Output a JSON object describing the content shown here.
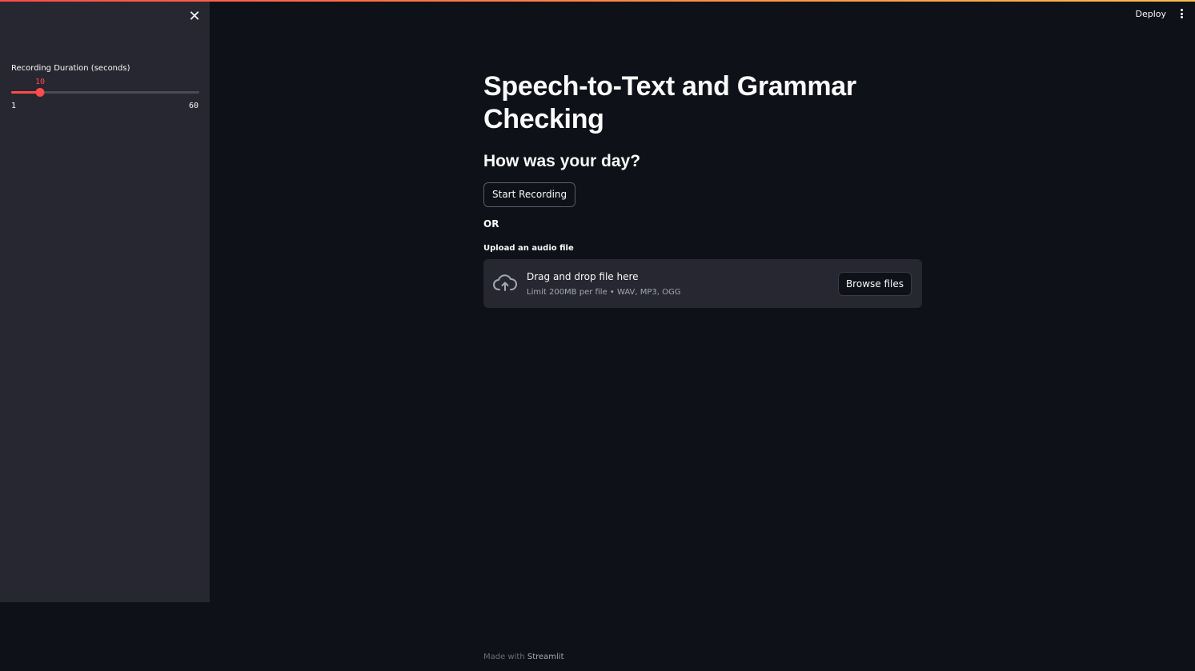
{
  "colors": {
    "accent": "#ff4b4b",
    "background": "#0e1117",
    "sidebar": "#262730"
  },
  "sidebar": {
    "close_icon": "close-icon",
    "slider": {
      "label": "Recording Duration (seconds)",
      "value": "10",
      "min": "1",
      "max": "60",
      "level": 0.153
    }
  },
  "header": {
    "deploy_label": "Deploy",
    "menu_icon": "vertical-ellipsis-icon"
  },
  "main": {
    "title": "Speech-to-Text and Grammar Checking",
    "subheader": "How was your day?",
    "record_button": "Start Recording",
    "or_text": "OR",
    "upload": {
      "label": "Upload an audio file",
      "icon": "cloud-upload-icon",
      "drop_title": "Drag and drop file here",
      "drop_subtitle": "Limit 200MB per file • WAV, MP3, OGG",
      "browse_button": "Browse files"
    }
  },
  "footer": {
    "made_with": "Made with",
    "brand": "Streamlit"
  }
}
